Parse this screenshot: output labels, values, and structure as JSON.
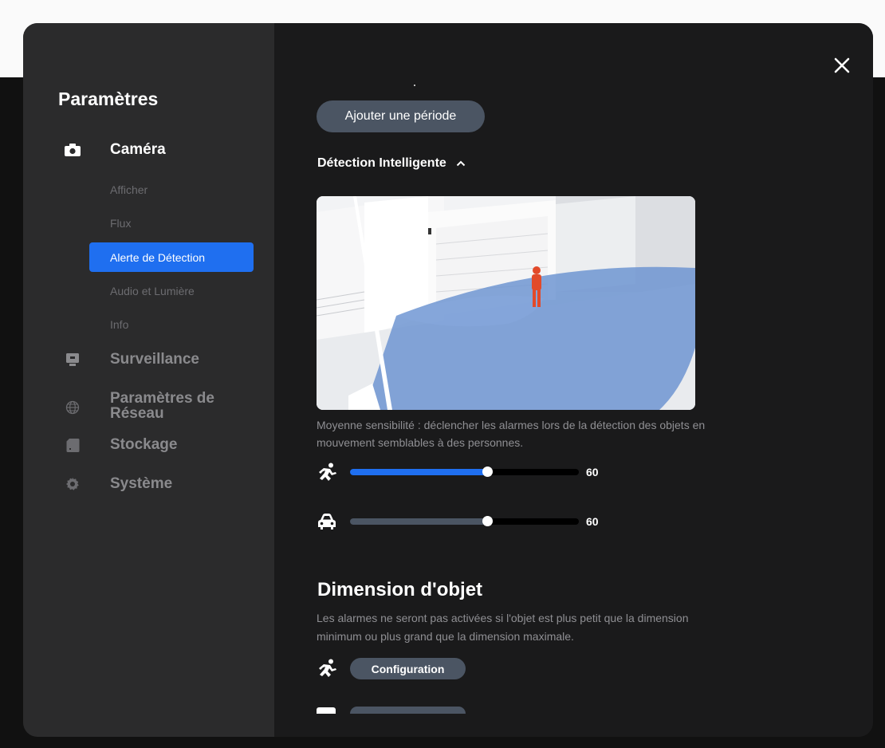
{
  "sidebar": {
    "title": "Paramètres",
    "sections": [
      {
        "label": "Caméra",
        "icon": "camera-icon",
        "active": true
      },
      {
        "label": "Surveillance",
        "icon": "monitor-icon"
      },
      {
        "label": "Paramètres de\nRéseau",
        "icon": "globe-icon"
      },
      {
        "label": "Stockage",
        "icon": "sd-card-icon"
      },
      {
        "label": "Système",
        "icon": "gear-icon"
      }
    ],
    "camera_items": [
      {
        "label": "Afficher"
      },
      {
        "label": "Flux"
      },
      {
        "label": "Alerte de Détection",
        "active": true
      },
      {
        "label": "Audio et Lumière"
      },
      {
        "label": "Info"
      }
    ]
  },
  "content": {
    "add_period_label": "Ajouter une période",
    "smart_detection": {
      "title": "Détection Intelligente",
      "description": "Moyenne sensibilité : déclencher les alarmes lors de la détection des objets en mouvement semblables à des personnes.",
      "sliders": [
        {
          "icon": "person-running-icon",
          "value": 60,
          "max": 100,
          "fill_color": "#1f6ff0"
        },
        {
          "icon": "car-icon",
          "value": 60,
          "max": 100,
          "fill_color": "#4b5563"
        }
      ]
    },
    "object_dimension": {
      "title": "Dimension d'objet",
      "description": "Les alarmes ne seront pas activées si l'objet est plus petit que la dimension minimum ou plus grand que la dimension maximale.",
      "buttons": [
        {
          "icon": "person-running-icon",
          "label": "Configuration"
        }
      ]
    }
  },
  "colors": {
    "accent": "#1f6ff0",
    "button_bg": "#4b5563",
    "sidebar_bg": "#2b2b2c",
    "content_bg": "#1a1a1b"
  }
}
